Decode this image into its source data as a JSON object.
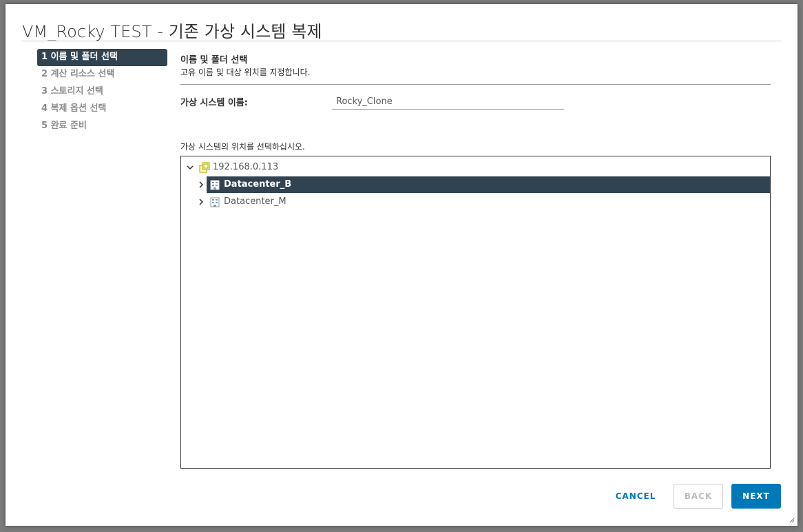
{
  "dialog": {
    "title": "VM_Rocky TEST - 기존 가상 시스템 복제"
  },
  "steps": [
    {
      "label": "1 이름 및 폴더 선택",
      "active": true
    },
    {
      "label": "2 계산 리소스 선택",
      "active": false
    },
    {
      "label": "3 스토리지 선택",
      "active": false
    },
    {
      "label": "4 복제 옵션 선택",
      "active": false
    },
    {
      "label": "5 완료 준비",
      "active": false
    }
  ],
  "section": {
    "title": "이름 및 폴더 선택",
    "subtitle": "고유 이름 및 대상 위치를 지정합니다."
  },
  "vm_name": {
    "label": "가상 시스템 이름:",
    "value": "Rocky_Clone"
  },
  "location": {
    "label": "가상 시스템의 위치를 선택하십시오."
  },
  "tree": {
    "root": {
      "label": "192.168.0.113",
      "icon": "vcenter-icon",
      "expanded": true
    },
    "children": [
      {
        "label": "Datacenter_B",
        "icon": "datacenter-icon",
        "selected": true
      },
      {
        "label": "Datacenter_M",
        "icon": "datacenter-icon",
        "selected": false
      }
    ]
  },
  "buttons": {
    "cancel": "CANCEL",
    "back": "BACK",
    "next": "NEXT"
  },
  "colors": {
    "accent": "#0079b8",
    "selected_bg": "#314351"
  }
}
